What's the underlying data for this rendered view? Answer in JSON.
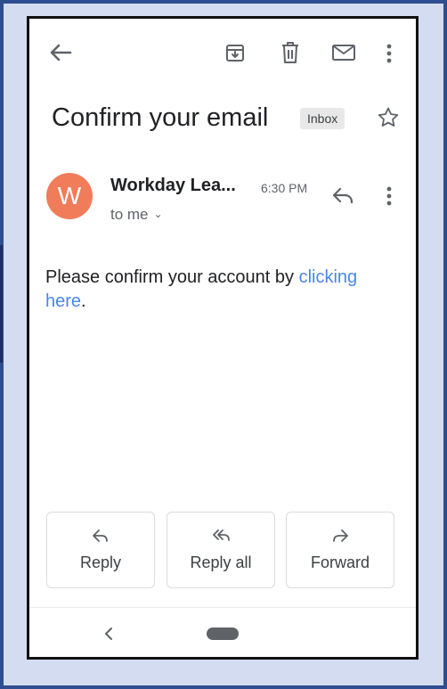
{
  "email": {
    "subject": "Confirm your email",
    "label_badge": "Inbox",
    "sender_initial": "W",
    "sender_name": "Workday Lea...",
    "time": "6:30 PM",
    "recipient": "to me",
    "body_text": "Please confirm your account by ",
    "body_link": "clicking here",
    "body_tail": "."
  },
  "actions": {
    "reply_label": "Reply",
    "reply_all_label": "Reply all",
    "forward_label": "Forward"
  },
  "colors": {
    "avatar": "#f07c5a",
    "link": "#4a86e8",
    "frame_border": "#2f4e8f",
    "frame_background": "#d3dcf0"
  },
  "icons": {
    "toolbar": [
      "back-arrow-icon",
      "archive-icon",
      "trash-icon",
      "mail-icon",
      "more-vertical-icon"
    ],
    "header": [
      "star-icon"
    ],
    "message": [
      "reply-icon",
      "more-vertical-icon"
    ],
    "buttons": [
      "reply-icon",
      "reply-all-icon",
      "forward-icon"
    ],
    "nav": [
      "nav-back-icon",
      "home-pill"
    ]
  }
}
